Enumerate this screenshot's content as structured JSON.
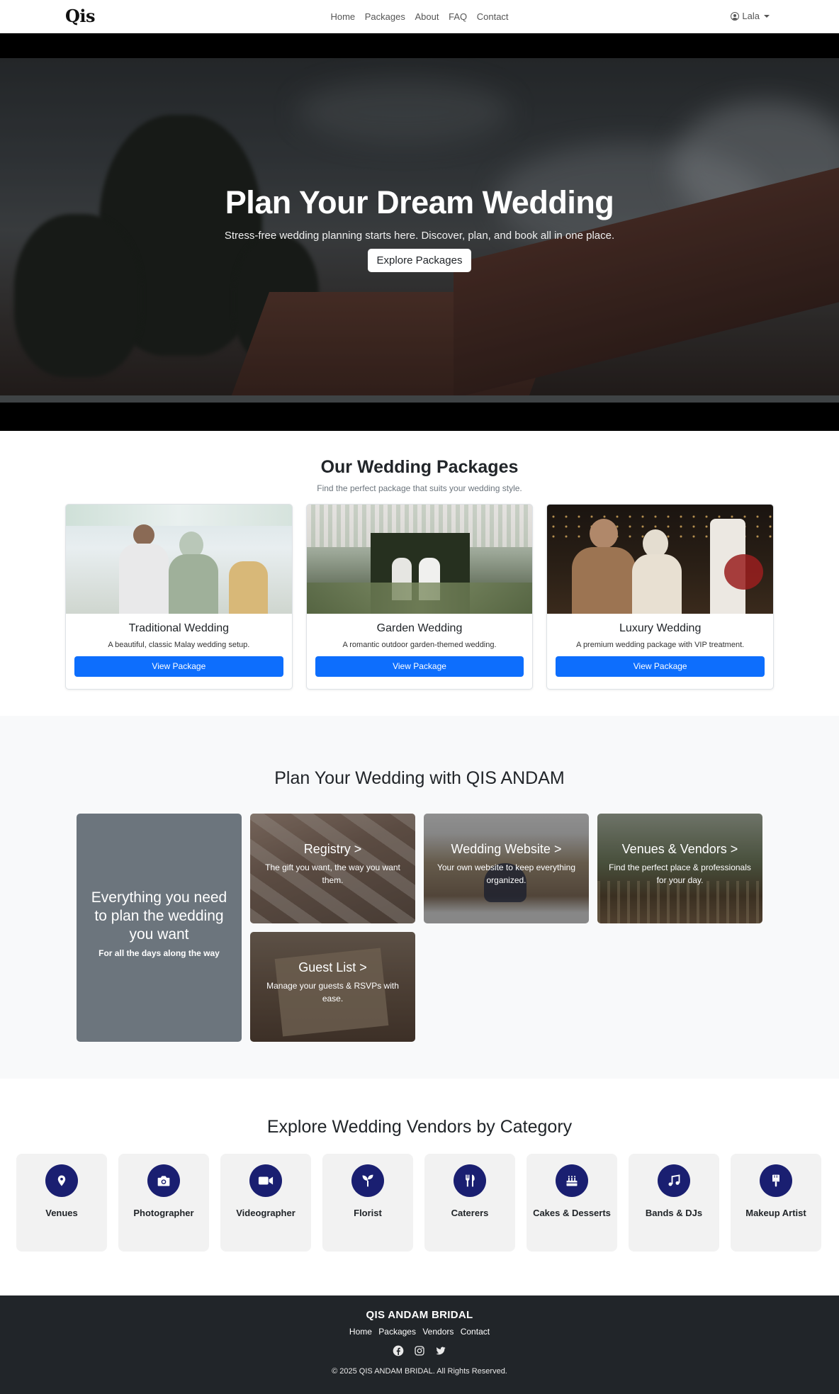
{
  "nav": {
    "logo": "Qis",
    "links": [
      "Home",
      "Packages",
      "About",
      "FAQ",
      "Contact"
    ],
    "user": "Lala"
  },
  "hero": {
    "title": "Plan Your Dream Wedding",
    "subtitle": "Stress-free wedding planning starts here. Discover, plan, and book all in one place.",
    "button": "Explore Packages"
  },
  "packages": {
    "title": "Our Wedding Packages",
    "subtitle": "Find the perfect package that suits your wedding style.",
    "items": [
      {
        "title": "Traditional Wedding",
        "desc": "A beautiful, classic Malay wedding setup.",
        "button": "View Package"
      },
      {
        "title": "Garden Wedding",
        "desc": "A romantic outdoor garden-themed wedding.",
        "button": "View Package"
      },
      {
        "title": "Luxury Wedding",
        "desc": "A premium wedding package with VIP treatment.",
        "button": "View Package"
      }
    ]
  },
  "plan": {
    "title": "Plan Your Wedding with QIS ANDAM",
    "panel_title": "Everything you need to plan the wedding you want",
    "panel_sub": "For all the days along the way",
    "tiles": [
      {
        "title": "Registry >",
        "desc": "The gift you want, the way you want them."
      },
      {
        "title": "Wedding Website >",
        "desc": "Your own website to keep everything organized."
      },
      {
        "title": "Venues & Vendors >",
        "desc": "Find the perfect place & professionals for your day."
      },
      {
        "title": "Guest List >",
        "desc": "Manage your guests & RSVPs with ease."
      }
    ]
  },
  "vendors": {
    "title": "Explore Wedding Vendors by Category",
    "items": [
      {
        "label": "Venues",
        "icon": "map-pin-icon"
      },
      {
        "label": "Photographer",
        "icon": "camera-icon"
      },
      {
        "label": "Videographer",
        "icon": "video-camera-icon"
      },
      {
        "label": "Florist",
        "icon": "sprout-icon"
      },
      {
        "label": "Caterers",
        "icon": "utensils-icon"
      },
      {
        "label": "Cakes & Desserts",
        "icon": "cake-icon"
      },
      {
        "label": "Bands & DJs",
        "icon": "music-icon"
      },
      {
        "label": "Makeup Artist",
        "icon": "makeup-brush-icon"
      }
    ]
  },
  "footer": {
    "brand": "QIS ANDAM BRIDAL",
    "links": [
      "Home",
      "Packages",
      "Vendors",
      "Contact"
    ],
    "copyright": "© 2025 QIS ANDAM BRIDAL. All Rights Reserved."
  },
  "colors": {
    "primary": "#0d6efd",
    "icon_bg": "#1a1f71",
    "footer_bg": "#212529",
    "panel_bg": "#6c757d"
  }
}
